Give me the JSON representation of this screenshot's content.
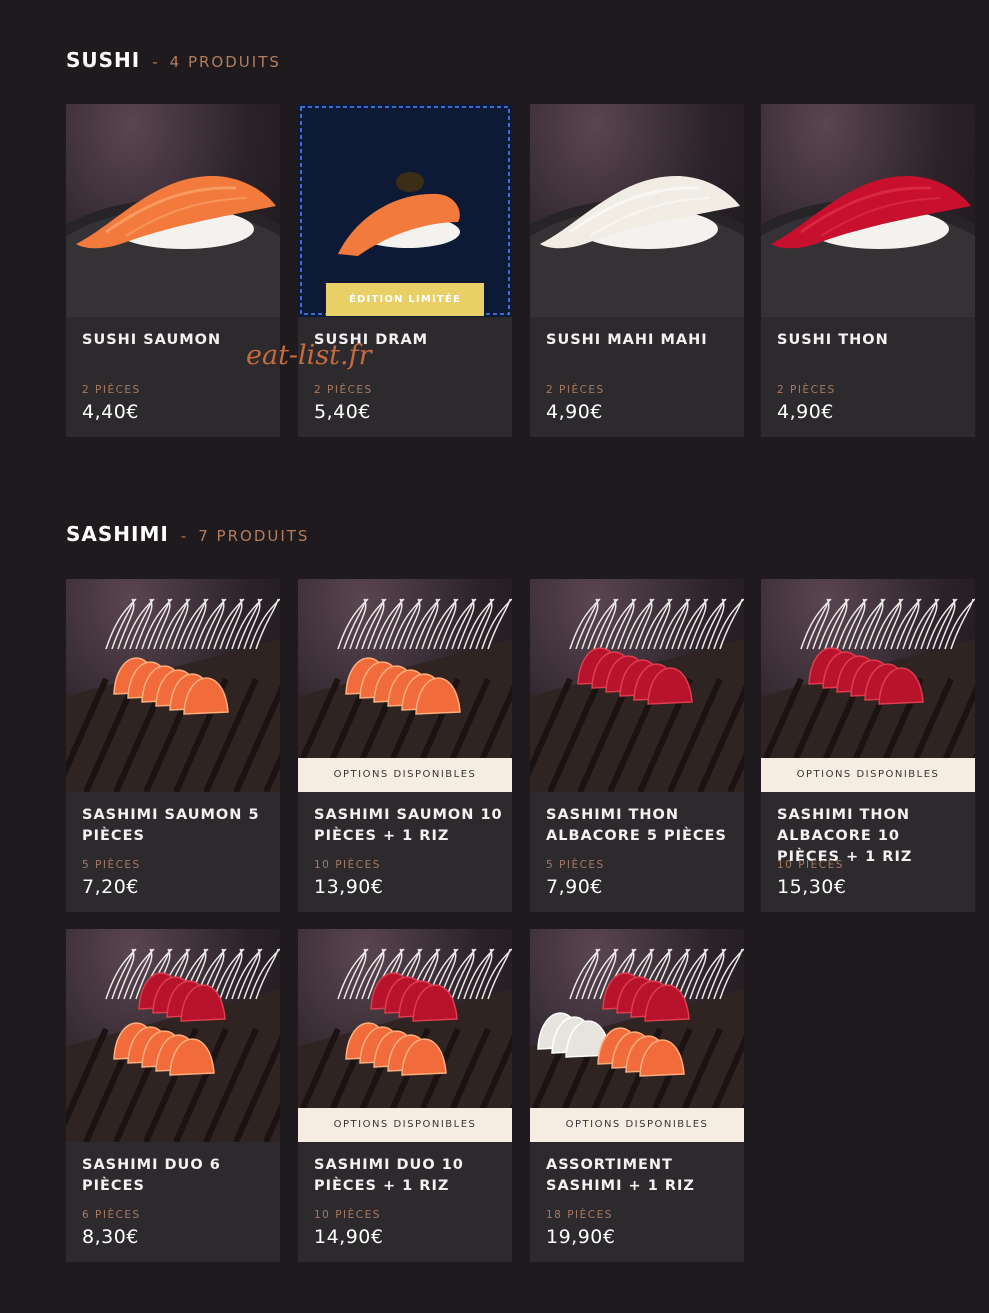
{
  "watermark": "eat-list.fr",
  "sections": [
    {
      "title": "SUSHI",
      "separator": "-",
      "count": "4 PRODUITS",
      "products": [
        {
          "name": "SUSHI SAUMON",
          "pieces": "2 PIÈCES",
          "price": "4,40€",
          "banner": ""
        },
        {
          "name": "SUSHI DRAM",
          "pieces": "2 PIÈCES",
          "price": "5,40€",
          "banner": "ÉDITION LIMITÉE"
        },
        {
          "name": "SUSHI MAHI MAHI",
          "pieces": "2 PIÈCES",
          "price": "4,90€",
          "banner": ""
        },
        {
          "name": "SUSHI THON",
          "pieces": "2 PIÈCES",
          "price": "4,90€",
          "banner": ""
        }
      ]
    },
    {
      "title": "SASHIMI",
      "separator": "-",
      "count": "7 PRODUITS",
      "products": [
        {
          "name": "SASHIMI SAUMON 5 PIÈCES",
          "pieces": "5 PIÈCES",
          "price": "7,20€",
          "banner": ""
        },
        {
          "name": "SASHIMI SAUMON 10 PIÈCES + 1 RIZ",
          "pieces": "10 PIÈCES",
          "price": "13,90€",
          "banner": "OPTIONS DISPONIBLES"
        },
        {
          "name": "SASHIMI THON ALBACORE 5 PIÈCES",
          "pieces": "5 PIÈCES",
          "price": "7,90€",
          "banner": ""
        },
        {
          "name": "SASHIMI THON ALBACORE 10 PIÈCES + 1 RIZ",
          "pieces": "10 PIÈCES",
          "price": "15,30€",
          "banner": "OPTIONS DISPONIBLES"
        },
        {
          "name": "SASHIMI DUO 6 PIÈCES",
          "pieces": "6 PIÈCES",
          "price": "8,30€",
          "banner": ""
        },
        {
          "name": "SASHIMI DUO 10 PIÈCES + 1 RIZ",
          "pieces": "10 PIÈCES",
          "price": "14,90€",
          "banner": "OPTIONS DISPONIBLES"
        },
        {
          "name": "ASSORTIMENT SASHIMI + 1 RIZ",
          "pieces": "18 PIÈCES",
          "price": "19,90€",
          "banner": "OPTIONS DISPONIBLES"
        }
      ]
    }
  ],
  "images": [
    {
      "kind": "nigiri",
      "fish": "salmon"
    },
    {
      "kind": "nigiri",
      "fish": "salmon-caviar"
    },
    {
      "kind": "nigiri",
      "fish": "white"
    },
    {
      "kind": "nigiri",
      "fish": "tuna"
    },
    {
      "kind": "sashimi",
      "fish": "salmon"
    },
    {
      "kind": "sashimi",
      "fish": "salmon"
    },
    {
      "kind": "sashimi",
      "fish": "tuna"
    },
    {
      "kind": "sashimi",
      "fish": "tuna"
    },
    {
      "kind": "sashimi",
      "fish": "duo"
    },
    {
      "kind": "sashimi",
      "fish": "duo"
    },
    {
      "kind": "sashimi",
      "fish": "assorted"
    }
  ]
}
